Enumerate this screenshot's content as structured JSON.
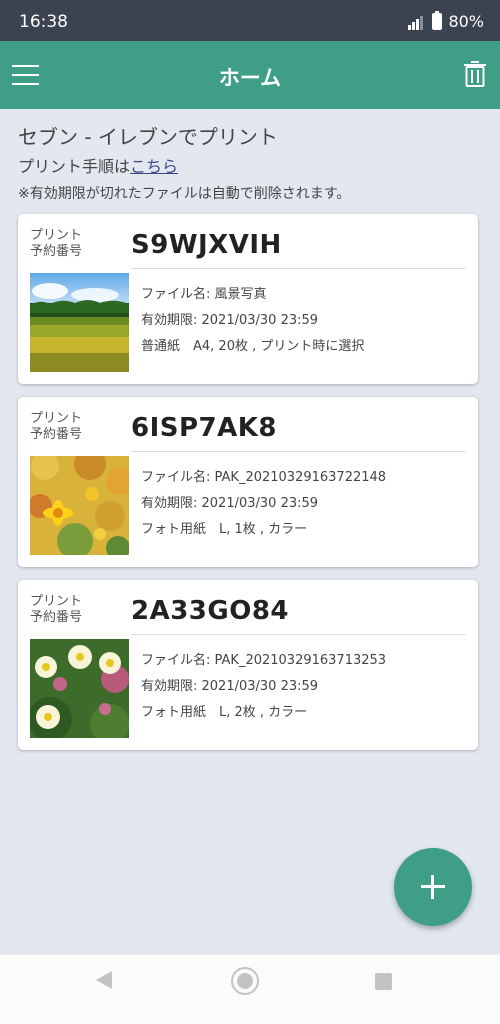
{
  "status_bar": {
    "time": "16:38",
    "battery": "80%"
  },
  "app_bar": {
    "title": "ホーム"
  },
  "header": {
    "title": "セブン - イレブンでプリント",
    "link_prefix": "プリント手順は",
    "link_text": "こちら",
    "note": "※有効期限が切れたファイルは自動で削除されます。"
  },
  "reservations": [
    {
      "label_line1": "プリント",
      "label_line2": "予約番号",
      "code": "S9WJXVIH",
      "file_name": "ファイル名: 風景写真",
      "expiry": "有効期限: 2021/03/30 23:59",
      "details": "普通紙　A4, 20枚 , プリント時に選択"
    },
    {
      "label_line1": "プリント",
      "label_line2": "予約番号",
      "code": "6ISP7AK8",
      "file_name": "ファイル名: PAK_20210329163722148",
      "expiry": "有効期限: 2021/03/30 23:59",
      "details": "フォト用紙　L, 1枚 , カラー"
    },
    {
      "label_line1": "プリント",
      "label_line2": "予約番号",
      "code": "2A33GO84",
      "file_name": "ファイル名: PAK_20210329163713253",
      "expiry": "有効期限: 2021/03/30 23:59",
      "details": "フォト用紙　L, 2枚 , カラー"
    }
  ],
  "colors": {
    "accent": "#3e9e86",
    "status_bar": "#3b4250",
    "background": "#e3e7f0",
    "link": "#3b4a86"
  },
  "icons": [
    "menu-icon",
    "trash-icon",
    "add-icon",
    "back-icon",
    "home-icon",
    "recents-icon",
    "signal-icon",
    "battery-icon"
  ]
}
